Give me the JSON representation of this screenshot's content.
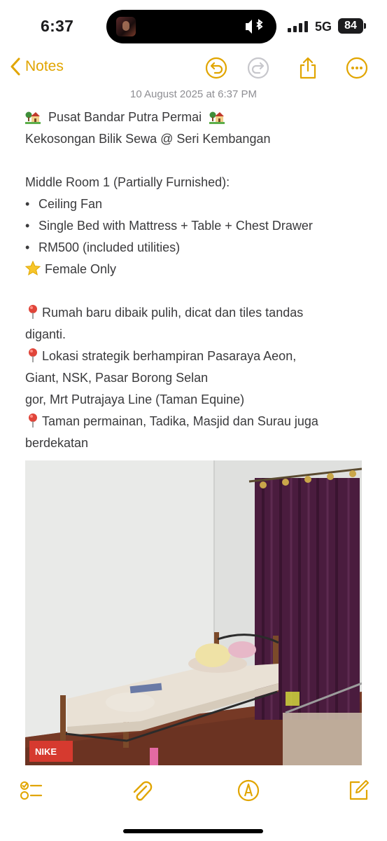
{
  "status_bar": {
    "time": "6:37",
    "network": "5G",
    "battery": "84"
  },
  "nav": {
    "back_label": "Notes",
    "accent_color": "#e1a500",
    "icons": [
      "chevron-left-icon",
      "undo-icon",
      "redo-icon",
      "share-icon",
      "more-icon"
    ]
  },
  "note": {
    "date": "10 August 2025 at 6:37 PM",
    "title": "Pusat Bandar Putra Permai",
    "subtitle": "Kekosongan Bilik Sewa @ Seri Kembangan",
    "room_heading": "Middle Room 1 (Partially Furnished):",
    "bullets": [
      "Ceiling Fan",
      "Single Bed with Mattress + Table + Chest Drawer",
      "RM500 (included utilities)"
    ],
    "female_only": "Female Only",
    "pins": [
      [
        "Rumah baru dibaik pulih, dicat dan tiles tandas",
        "diganti."
      ],
      [
        "Lokasi strategik berhampiran Pasaraya Aeon,",
        "Giant, NSK, Pasar Borong Selan",
        "gor, Mrt Putrajaya Line (Taman Equine)"
      ],
      [
        "Taman permainan, Tadika, Masjid dan Surau juga",
        "berdekatan"
      ]
    ],
    "photo_box_label": "NIKE"
  },
  "toolbar": {
    "icons": [
      "checklist-icon",
      "attachment-icon",
      "markup-icon",
      "compose-icon"
    ]
  }
}
